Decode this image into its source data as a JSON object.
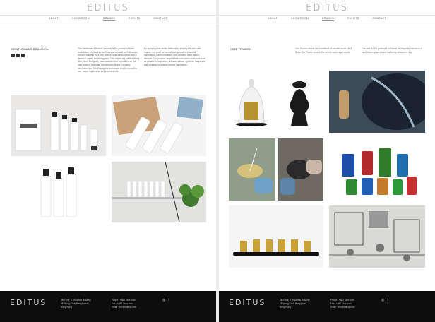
{
  "logo": "EDITUS",
  "nav": [
    "ABOUT",
    "SHOWROOM",
    "BRANDS",
    "EVENTS",
    "CONTACT"
  ],
  "left": {
    "brand_title": "GENTLEMANS BRAND Co.",
    "col1": "The Gentleman's Brand Company is the product of three Australians - A Creative, an Entrepreneur and an Enthusiast - brought together by a love of their local surroundings and a desire to create something new. The unique appeal is a Men's Skin Care. Designed, manufactured and formulated on the east coast of Australia, Gentleman's Brand Company celebrates the Goh Eucalyptus landscape and it's incredible rich, native ingredients and essential oils.",
    "col2": "By applying time-tested methods to simplify the skin care regime, we strive for honest and grounded essential ingredients. Each botanical's and premium plant-based extracts. Our product range is free from harsh chemicals such as parabens, sulphates, artificial colours, synthetic fragrances and contains no animal derived ingredients.",
    "images": [
      "product-box-image",
      "bottles-tilted-image",
      "pump-bottles-image",
      "shelf-plant-image"
    ]
  },
  "right": {
    "brand_title": "CIRE TRUDON",
    "col1": "Cire Trudon retains the excellence of candles since 1643. Rebs Cire Trudon crowns the world's most regal courts.",
    "col2": "The wax, 100% produced in France, is elegantly housed in a hand-blown glass vessel crafted by artisans in Italy.",
    "images": [
      "candle-bust-image",
      "blue-glass-image",
      "wick-hands-image",
      "colored-glass-candles-image",
      "candle-row-image",
      "engraving-image"
    ]
  },
  "footer": {
    "logo": "EDITUS",
    "address": [
      "5th Floor, K Industrial Building",
      "58 Wong Chuk Hang Road",
      "Hong Kong"
    ],
    "contact": [
      "Phone : +852 2xxx xxxx",
      "Fax : +852 2xxx xxxx",
      "Email : info@editus.com"
    ],
    "social": [
      "instagram",
      "facebook"
    ]
  }
}
